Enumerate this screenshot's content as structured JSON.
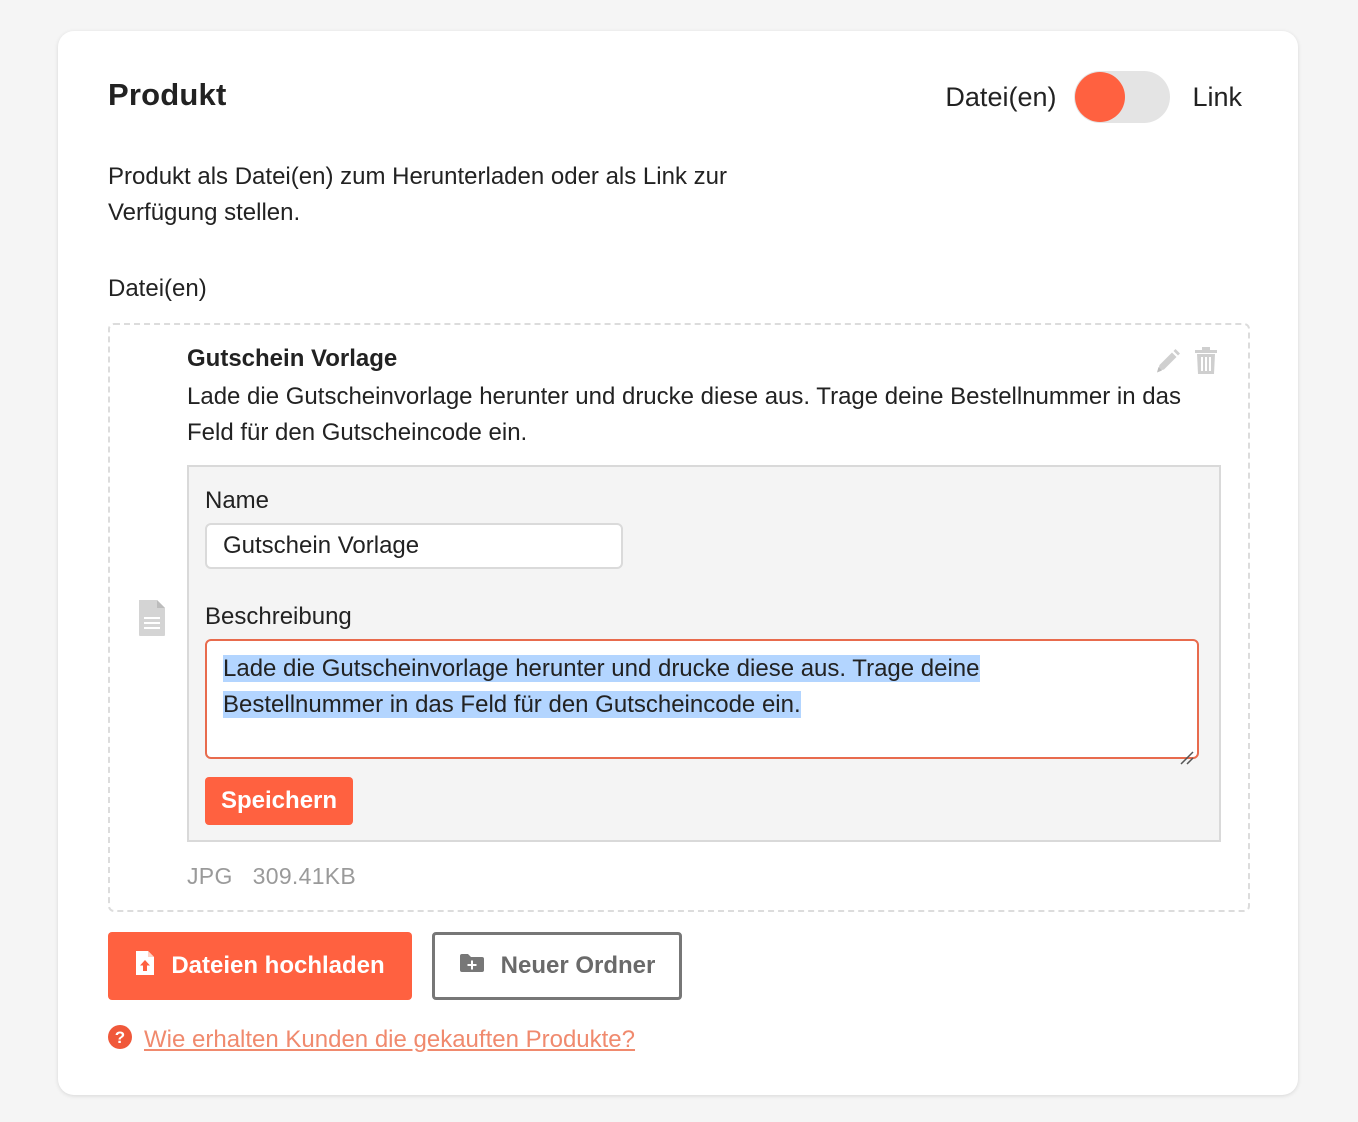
{
  "product": {
    "title": "Produkt",
    "toggle": {
      "left_label": "Datei(en)",
      "right_label": "Link",
      "state": "Datei(en)"
    },
    "description": "Produkt als Datei(en) zum Herunterladen oder als Link zur Verfügung stellen."
  },
  "files": {
    "section_label": "Datei(en)",
    "item": {
      "title": "Gutschein Vorlage",
      "description": "Lade die Gutscheinvorlage herunter und drucke diese aus. Trage deine Bestellnummer in das Feld für den Gutscheincode ein.",
      "icons": {
        "edit": "pencil-icon",
        "delete": "trash-icon",
        "file": "document-icon"
      },
      "form": {
        "name_label": "Name",
        "name_value": "Gutschein Vorlage",
        "description_label": "Beschreibung",
        "description_line1": "Lade die Gutscheinvorlage herunter und drucke diese aus. Trage deine",
        "description_line2": "Bestellnummer in das Feld für den Gutscheincode ein.",
        "save_label": "Speichern"
      },
      "meta": {
        "type": "JPG",
        "size": "309.41KB"
      }
    }
  },
  "actions": {
    "upload_label": "Dateien hochladen",
    "new_folder_label": "Neuer Ordner"
  },
  "help": {
    "link_text": "Wie erhalten Kunden die gekauften Produkte?"
  },
  "colors": {
    "accent": "#ff6140",
    "selection": "#b3d5ff",
    "link": "#f08a6e"
  }
}
